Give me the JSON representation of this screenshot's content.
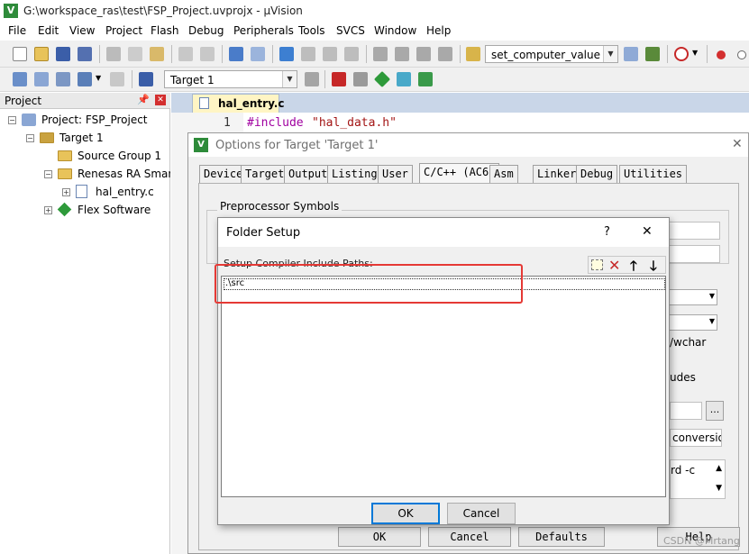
{
  "window": {
    "title": "G:\\workspace_ras\\test\\FSP_Project.uvprojx - µVision",
    "app_icon": "V"
  },
  "menu": [
    "File",
    "Edit",
    "View",
    "Project",
    "Flash",
    "Debug",
    "Peripherals",
    "Tools",
    "SVCS",
    "Window",
    "Help"
  ],
  "toolbar": {
    "function_combo": "set_computer_value",
    "target_combo": "Target 1"
  },
  "project_panel": {
    "header": "Project",
    "tree": [
      "Project: FSP_Project",
      "Target 1",
      "Source Group 1",
      "Renesas RA Smart Configurator",
      "hal_entry.c",
      "Flex Software"
    ]
  },
  "editor": {
    "tab": "hal_entry.c",
    "line_number": "1",
    "code_keyword": "#include",
    "code_string": "\"hal_data.h\""
  },
  "options_dialog": {
    "title": "Options for Target 'Target 1'",
    "tabs": [
      "Device",
      "Target",
      "Output",
      "Listing",
      "User",
      "C/C++ (AC6)",
      "Asm",
      "Linker",
      "Debug",
      "Utilities"
    ],
    "active_tab": "C/C++ (AC6)",
    "group_label": "Preprocessor Symbols",
    "visible_fragments": [
      "/wchar",
      "udes",
      "conversion",
      "rd -c"
    ],
    "ok": "OK",
    "cancel": "Cancel",
    "defaults": "Defaults",
    "help": "Help"
  },
  "folder_setup": {
    "title": "Folder Setup",
    "help_glyph": "?",
    "close_glyph": "✕",
    "label": "Setup Compiler Include Paths:",
    "paths": [
      ".\\src"
    ],
    "ok": "OK",
    "cancel": "Cancel"
  },
  "watermark": "CSDN @Mrtang",
  "colors": {
    "highlight": "#e53935",
    "editor_tab": "#fff5c4",
    "keyword": "#a000a0",
    "string": "#a31515"
  }
}
